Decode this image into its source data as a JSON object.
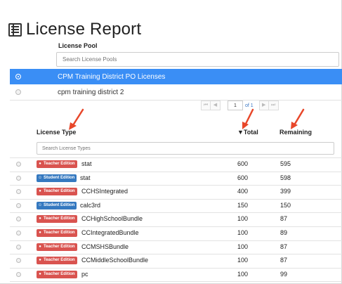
{
  "page": {
    "title": "License Report",
    "accent_color": "#3a8ef5"
  },
  "pool": {
    "header": "License Pool",
    "search_placeholder": "Search License Pools",
    "items": [
      {
        "label": "CPM Training District PO Licenses",
        "selected": true
      },
      {
        "label": "cpm training district 2",
        "selected": false
      }
    ]
  },
  "pager": {
    "first_icon": "first-page-icon",
    "prev_icon": "prev-page-icon",
    "next_icon": "next-page-icon",
    "last_icon": "last-page-icon",
    "current_page": "1",
    "of_label": "of 1"
  },
  "types": {
    "col_type": "License Type",
    "col_total": "▼Total",
    "col_remaining": "Remaining",
    "search_placeholder": "Search License Types",
    "teacher_label": "Teacher Edition",
    "student_label": "Student Edition",
    "teacher_color": "#d9534f",
    "student_color": "#3579c0",
    "rows": [
      {
        "edition": "teacher",
        "edition_label": "Teacher Edition",
        "name": "stat",
        "total": "600",
        "remaining": "595"
      },
      {
        "edition": "student",
        "edition_label": "Student Edition",
        "name": "stat",
        "total": "600",
        "remaining": "598"
      },
      {
        "edition": "teacher",
        "edition_label": "Teacher Edition",
        "name": "CCHSIntegrated",
        "total": "400",
        "remaining": "399"
      },
      {
        "edition": "student",
        "edition_label": "Student Edition",
        "name": "calc3rd",
        "total": "150",
        "remaining": "150"
      },
      {
        "edition": "teacher",
        "edition_label": "Teacher Edition",
        "name": "CCHighSchoolBundle",
        "total": "100",
        "remaining": "87"
      },
      {
        "edition": "teacher",
        "edition_label": "Teacher Edition",
        "name": "CCIntegratedBundle",
        "total": "100",
        "remaining": "89"
      },
      {
        "edition": "teacher",
        "edition_label": "Teacher Edition",
        "name": "CCMSHSBundle",
        "total": "100",
        "remaining": "87"
      },
      {
        "edition": "teacher",
        "edition_label": "Teacher Edition",
        "name": "CCMiddleSchoolBundle",
        "total": "100",
        "remaining": "87"
      },
      {
        "edition": "teacher",
        "edition_label": "Teacher Edition",
        "name": "pc",
        "total": "100",
        "remaining": "99"
      }
    ]
  },
  "annotation_arrow_color": "#e8472a"
}
